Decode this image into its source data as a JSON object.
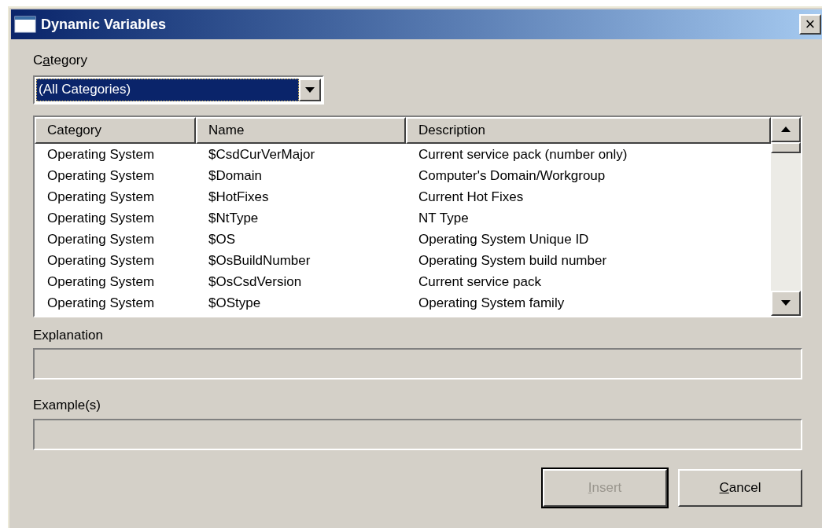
{
  "window": {
    "title": "Dynamic Variables",
    "close": "×"
  },
  "category_filter": {
    "label": {
      "before": "C",
      "key": "a",
      "after": "tegory"
    },
    "value": "(All Categories)",
    "focused": true
  },
  "table": {
    "columns": [
      "Category",
      "Name",
      "Description"
    ],
    "rows": [
      {
        "category": "Operating System",
        "name": "$CsdCurVerMajor",
        "description": "Current service pack (number only)"
      },
      {
        "category": "Operating System",
        "name": "$Domain",
        "description": "Computer's Domain/Workgroup"
      },
      {
        "category": "Operating System",
        "name": "$HotFixes",
        "description": "Current Hot Fixes"
      },
      {
        "category": "Operating System",
        "name": "$NtType",
        "description": "NT Type"
      },
      {
        "category": "Operating System",
        "name": "$OS",
        "description": "Operating System Unique ID"
      },
      {
        "category": "Operating System",
        "name": "$OsBuildNumber",
        "description": "Operating System build number"
      },
      {
        "category": "Operating System",
        "name": "$OsCsdVersion",
        "description": "Current service pack"
      },
      {
        "category": "Operating System",
        "name": "$OStype",
        "description": "Operating System family"
      }
    ]
  },
  "explanation": {
    "label": "Explanation"
  },
  "examples": {
    "label": "Example(s)"
  },
  "buttons": [
    {
      "label": {
        "key": "I",
        "after": "nsert"
      },
      "disabled": true,
      "default": true
    },
    {
      "label": {
        "key": "C",
        "after": "ancel"
      },
      "disabled": false,
      "default": false
    }
  ]
}
